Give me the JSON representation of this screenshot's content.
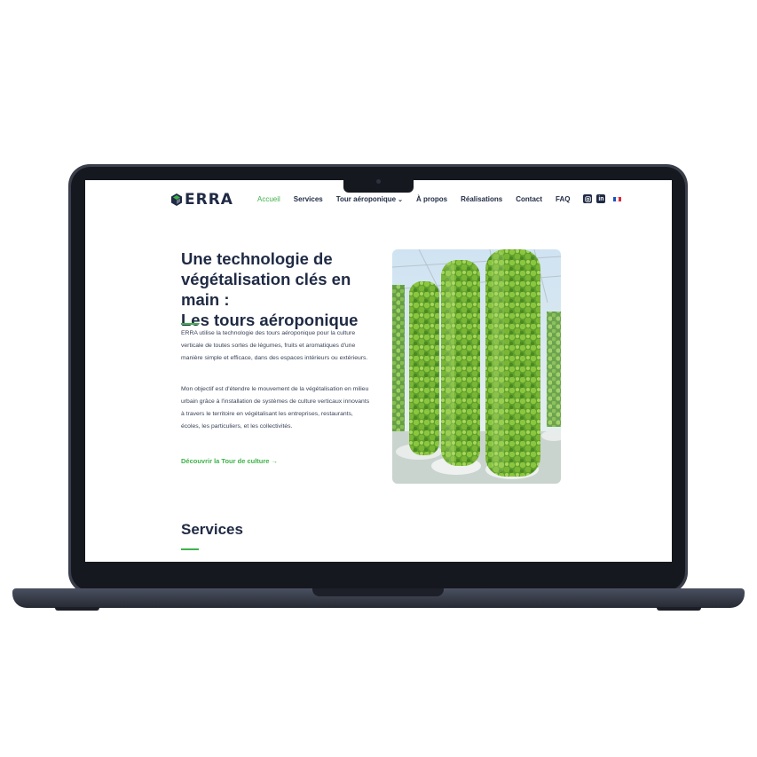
{
  "brand": {
    "name": "ERRA",
    "primary_color": "#1f2a44",
    "accent_color": "#3fb24a"
  },
  "nav": {
    "items": [
      {
        "label": "Accueil",
        "active": true
      },
      {
        "label": "Services"
      },
      {
        "label": "Tour aéroponique",
        "has_dropdown": true
      },
      {
        "label": "À propos"
      },
      {
        "label": "Réalisations"
      },
      {
        "label": "Contact"
      },
      {
        "label": "FAQ"
      }
    ],
    "social": [
      {
        "icon": "instagram-icon"
      },
      {
        "icon": "linkedin-icon",
        "glyph": "in"
      }
    ],
    "language": "fr-flag-icon"
  },
  "hero": {
    "title_line1": "Une technologie de",
    "title_line2": "végétalisation clés en main :",
    "title_line3": "Les tours aéroponique",
    "paragraph1": "ERRA utilise la technologie des tours aéroponique pour la culture verticale de toutes sortes de légumes, fruits et aromatiques d'une manière simple et efficace, dans des espaces intérieurs ou extérieurs.",
    "paragraph2": "Mon objectif est d'étendre le mouvement de la végétalisation en milieu urbain grâce à l'installation de systèmes de culture verticaux innovants à travers le territoire en végétalisant  les entreprises, restaurants, écoles, les particuliers, et les collectivités.",
    "cta": "Découvrir la Tour de culture →"
  },
  "services": {
    "title": "Services"
  }
}
